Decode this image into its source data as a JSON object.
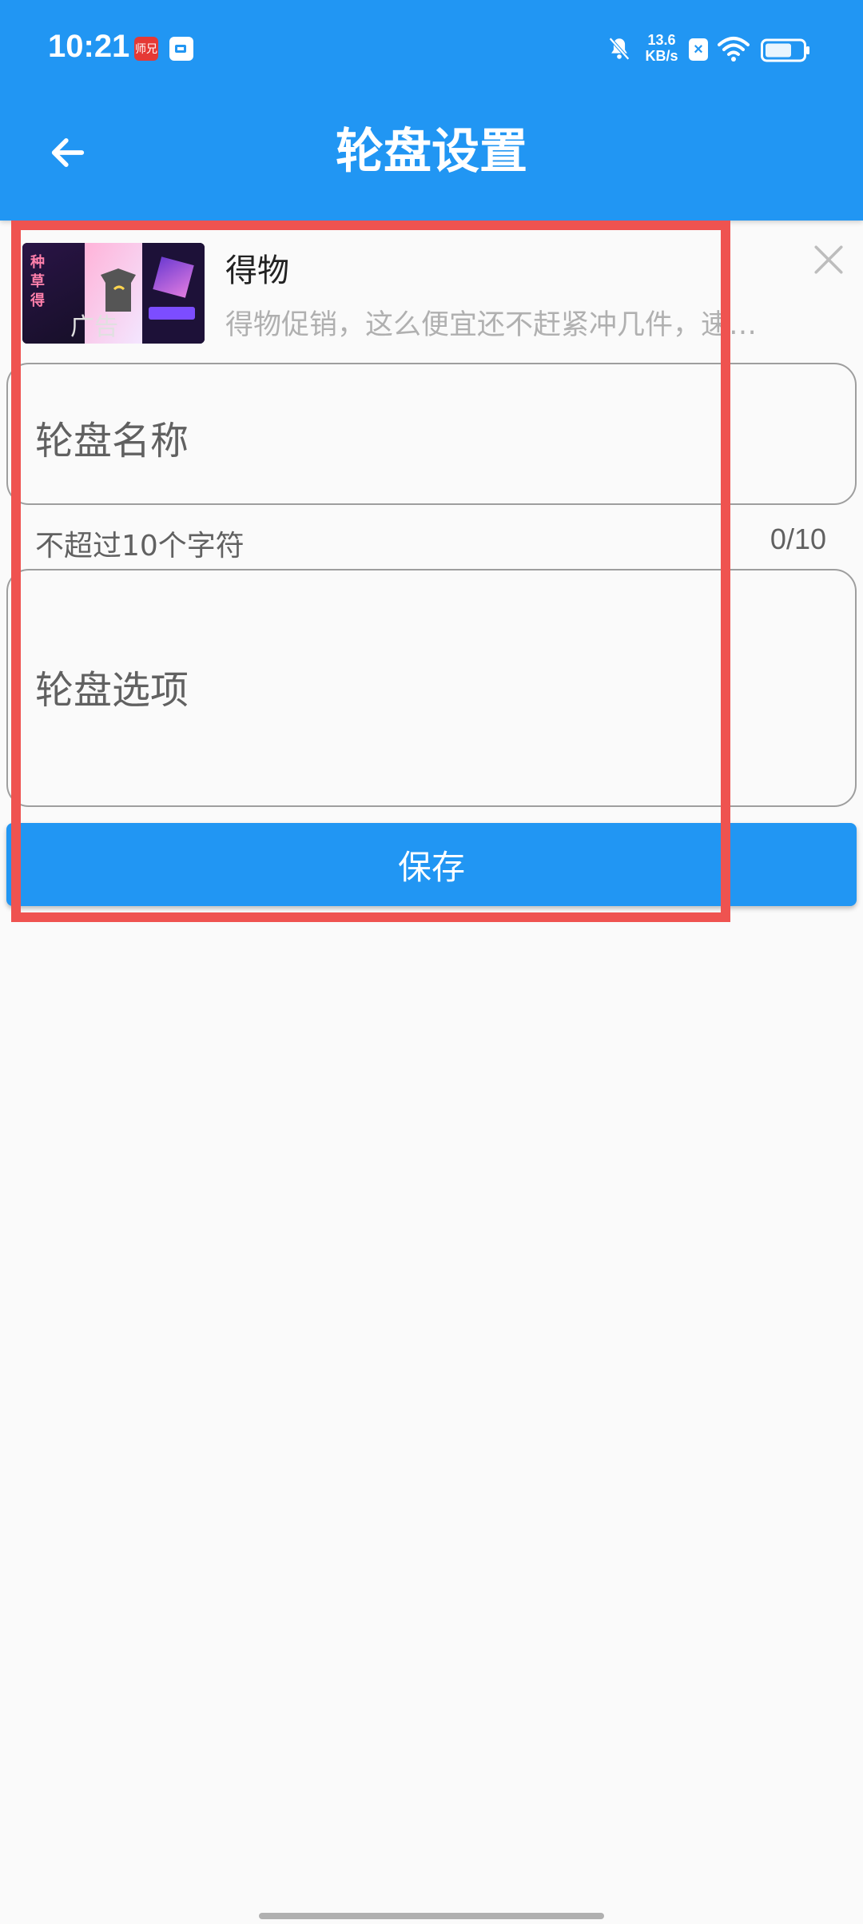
{
  "status_bar": {
    "time": "10:21",
    "app_badge_text": "师兄",
    "net_speed_value": "13.6",
    "net_speed_unit": "KB/s"
  },
  "app_bar": {
    "title": "轮盘设置",
    "back_icon": "arrow-left-icon",
    "color": "#2196f3"
  },
  "ad": {
    "title": "得物",
    "description": "得物促销，这么便宜还不赶紧冲几件，速…",
    "image_label": "广告",
    "close_icon": "close-icon"
  },
  "form": {
    "name_placeholder": "轮盘名称",
    "name_helper": "不超过10个字符",
    "name_counter": "0/10",
    "options_placeholder": "轮盘选项",
    "save_label": "保存"
  },
  "colors": {
    "primary": "#2196f3",
    "highlight": "#ef5350",
    "background": "#fafafa"
  }
}
